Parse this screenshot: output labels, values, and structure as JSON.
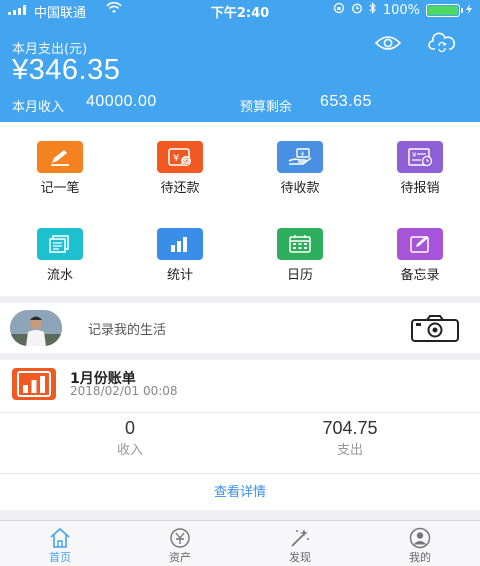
{
  "status_bar": {
    "carrier": "中国联通",
    "time": "下午2:40",
    "battery_text": "100%",
    "battery_level": 1.0
  },
  "header": {
    "month_expense_label": "本月支出(元)",
    "month_expense_amount": "¥346.35",
    "month_income_label": "本月收入",
    "month_income_value": "40000.00",
    "budget_remaining_label": "预算剩余",
    "budget_remaining_value": "653.65"
  },
  "colors": {
    "primary": "#43a4f0",
    "record": "#f58220",
    "repay": "#f05a22",
    "receive": "#4a90e2",
    "reimburse": "#8e5fd6",
    "flow": "#1ec0d0",
    "stats": "#3b8ee8",
    "calendar": "#2eaf5d",
    "memo": "#a654d8"
  },
  "grid": {
    "items": [
      {
        "label": "记一笔",
        "icon": "pencil-icon"
      },
      {
        "label": "待还款",
        "icon": "repay-icon"
      },
      {
        "label": "待收款",
        "icon": "receive-icon"
      },
      {
        "label": "待报销",
        "icon": "reimburse-icon"
      },
      {
        "label": "流水",
        "icon": "flow-icon"
      },
      {
        "label": "统计",
        "icon": "stats-icon"
      },
      {
        "label": "日历",
        "icon": "calendar-icon"
      },
      {
        "label": "备忘录",
        "icon": "memo-icon"
      }
    ]
  },
  "moments": {
    "text": "记录我的生活"
  },
  "bill": {
    "title": "1月份账单",
    "date": "2018/02/01 00:08",
    "income_value": "0",
    "income_label": "收入",
    "expense_value": "704.75",
    "expense_label": "支出",
    "detail_link": "查看详情"
  },
  "tabbar": {
    "tabs": [
      {
        "label": "首页",
        "icon": "home-icon",
        "active": true
      },
      {
        "label": "资产",
        "icon": "assets-icon",
        "active": false
      },
      {
        "label": "发现",
        "icon": "discover-icon",
        "active": false
      },
      {
        "label": "我的",
        "icon": "profile-icon",
        "active": false
      }
    ]
  }
}
